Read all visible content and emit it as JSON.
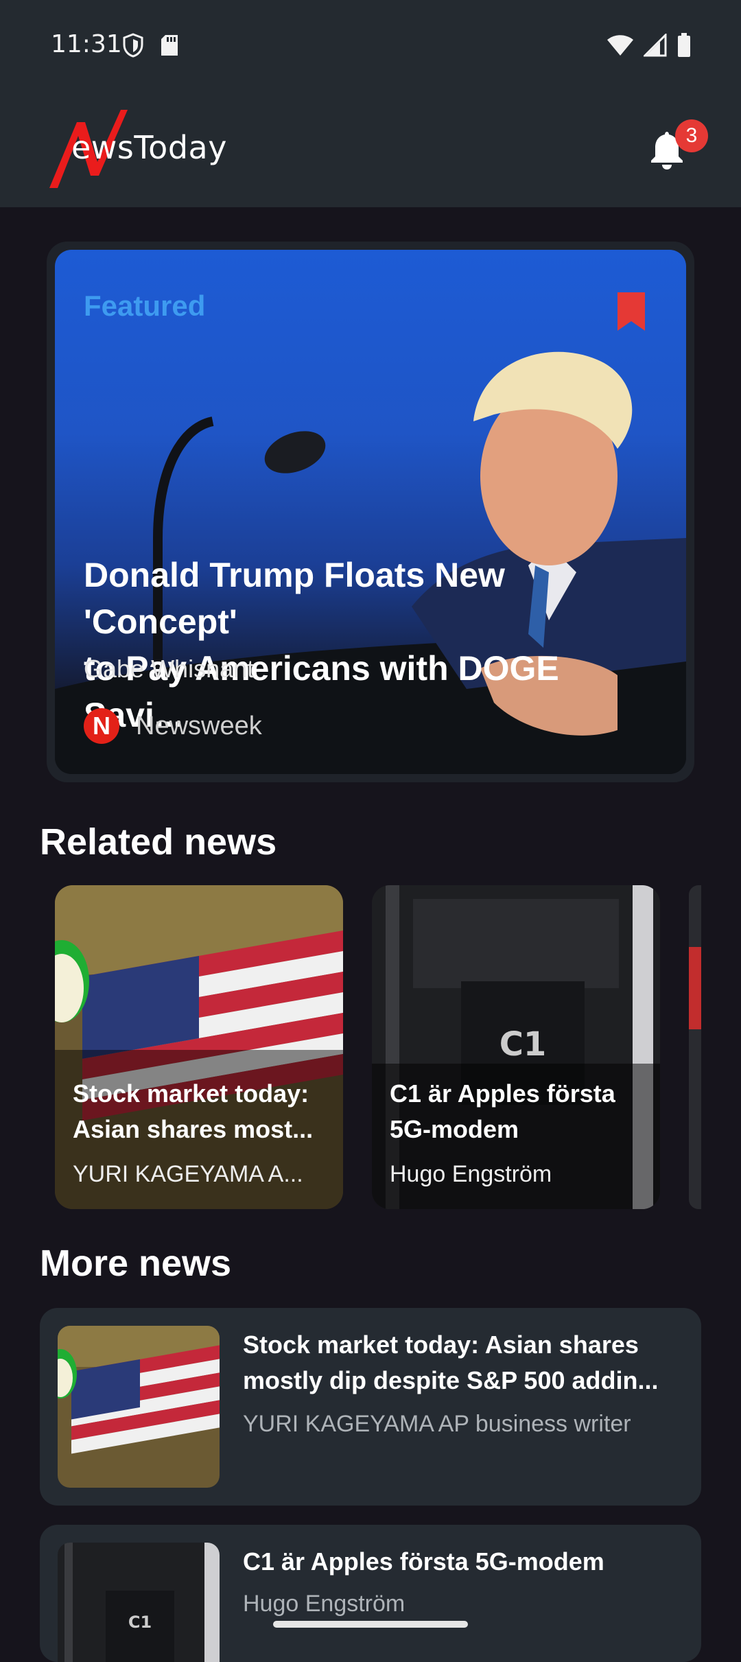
{
  "status_bar": {
    "time": "11:31"
  },
  "header": {
    "logo_text": "ewsToday",
    "notification_count": "3"
  },
  "featured": {
    "label": "Featured",
    "title": "Donald Trump Floats New 'Concept'\nto Pay Americans with DOGE Savi...",
    "author": "Gabe Whisnant",
    "source_initial": "N",
    "source_name": "Newsweek"
  },
  "related": {
    "heading": "Related news",
    "items": [
      {
        "title": "Stock market today:\nAsian shares most...",
        "author": "YURI KAGEYAMA A..."
      },
      {
        "title": "C1 är Apples första\n5G-modem",
        "author": "Hugo Engström"
      }
    ]
  },
  "more": {
    "heading": "More news",
    "items": [
      {
        "title": "Stock market today: Asian shares\nmostly dip despite S&P 500 addin...",
        "author": "YURI KAGEYAMA AP business writer"
      },
      {
        "title": "C1 är Apples första 5G-modem",
        "author": "Hugo Engström",
        "thumb_text": "C1"
      }
    ]
  },
  "colors": {
    "accent": "#3e9bf0",
    "brand_red": "#e32118",
    "bookmark": "#e53935",
    "card_bg": "#252b32"
  }
}
